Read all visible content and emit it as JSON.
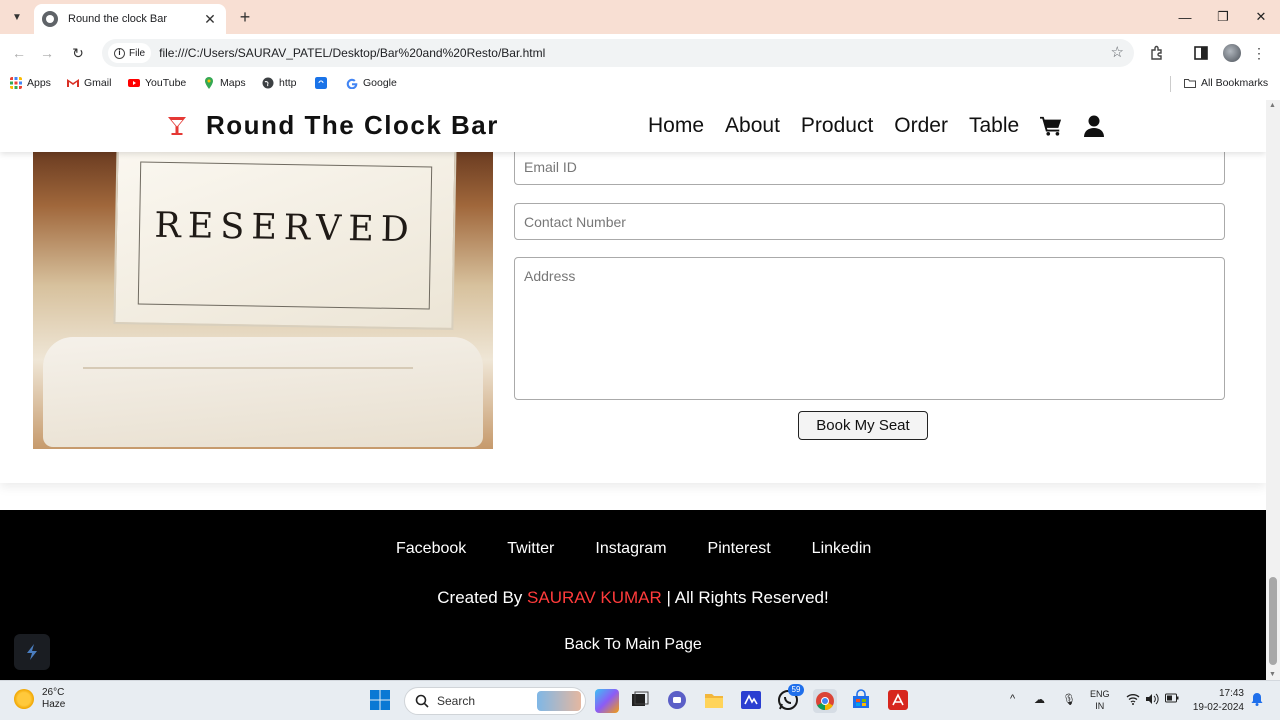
{
  "browser": {
    "tab_title": "Round the clock Bar",
    "url_chip": "File",
    "url": "file:///C:/Users/SAURAV_PATEL/Desktop/Bar%20and%20Resto/Bar.html",
    "bookmarks": [
      {
        "label": "Apps",
        "icon": "apps-grid-icon",
        "color": "#ea4335"
      },
      {
        "label": "Gmail",
        "icon": "gmail-icon",
        "color": "#d93025"
      },
      {
        "label": "YouTube",
        "icon": "youtube-icon",
        "color": "#ff0000"
      },
      {
        "label": "Maps",
        "icon": "maps-pin-icon",
        "color": "#34a853"
      },
      {
        "label": "http",
        "icon": "globe-icon",
        "color": "#3c4043"
      },
      {
        "label": "",
        "icon": "app-icon",
        "color": "#1a73e8"
      },
      {
        "label": "Google",
        "icon": "google-icon",
        "color": "#4285f4"
      }
    ],
    "all_bookmarks": "All Bookmarks"
  },
  "site": {
    "brand": "Round The Clock Bar",
    "brand_color": "#e53935",
    "nav": {
      "home": "Home",
      "about": "About",
      "product": "Product",
      "order": "Order",
      "table": "Table"
    }
  },
  "booking": {
    "photo_text": "RESERVED",
    "email_placeholder": "Email ID",
    "contact_placeholder": "Contact Number",
    "address_placeholder": "Address",
    "submit_label": "Book My Seat"
  },
  "footer": {
    "social": {
      "facebook": "Facebook",
      "twitter": "Twitter",
      "instagram": "Instagram",
      "pinterest": "Pinterest",
      "linkedin": "Linkedin"
    },
    "credit_prefix": "Created By",
    "credit_author": "SAURAV KUMAR",
    "credit_suffix": "| All Rights Reserved!",
    "back_link": "Back To Main Page",
    "author_color": "#ff3b3b"
  },
  "taskbar": {
    "temperature": "26°C",
    "condition": "Haze",
    "search_label": "Search",
    "notification_count": "59",
    "language_line1": "ENG",
    "language_line2": "IN",
    "time": "17:43",
    "date": "19-02-2024"
  }
}
